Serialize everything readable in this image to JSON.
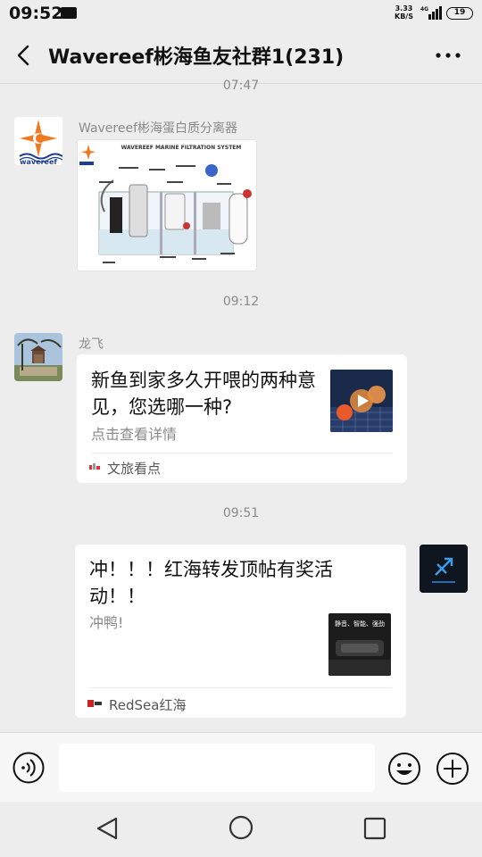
{
  "status_bar": {
    "time": "09:52",
    "net_speed_value": "3.33",
    "net_speed_unit": "KB/S",
    "network": "4G",
    "battery": "19"
  },
  "header": {
    "title": "Wavereef彬海鱼友社群1(231)",
    "back_icon": "chevron-left-icon",
    "more_icon": "more-dots-icon"
  },
  "messages": {
    "ts1": "07:47",
    "m1": {
      "sender": "Wavereef彬海蛋白质分离器",
      "avatar_logo_text": "wavereef",
      "image_caption": "WAVEREEF MARINE FILTRATION SYSTEM"
    },
    "ts2": "09:12",
    "m2": {
      "sender": "龙飞",
      "title": "新鱼到家多久开喂的两种意见，您选哪一种?",
      "desc": "点击查看详情",
      "source": "文旅看点"
    },
    "ts3": "09:51",
    "m3": {
      "title": "冲！！！红海转发顶帖有奖活动！！",
      "desc": "冲鸭!",
      "thumb_text": "静音、智能、强劲",
      "source": "RedSea红海"
    }
  },
  "input_bar": {
    "placeholder": "",
    "voice_icon": "voice-icon",
    "emoji_icon": "emoji-icon",
    "plus_icon": "plus-icon"
  },
  "colors": {
    "background": "#ededed",
    "card": "#ffffff",
    "meta_text": "#8a8a8a",
    "brand_orange": "#f07a23",
    "brand_blue": "#1c3f8f"
  }
}
